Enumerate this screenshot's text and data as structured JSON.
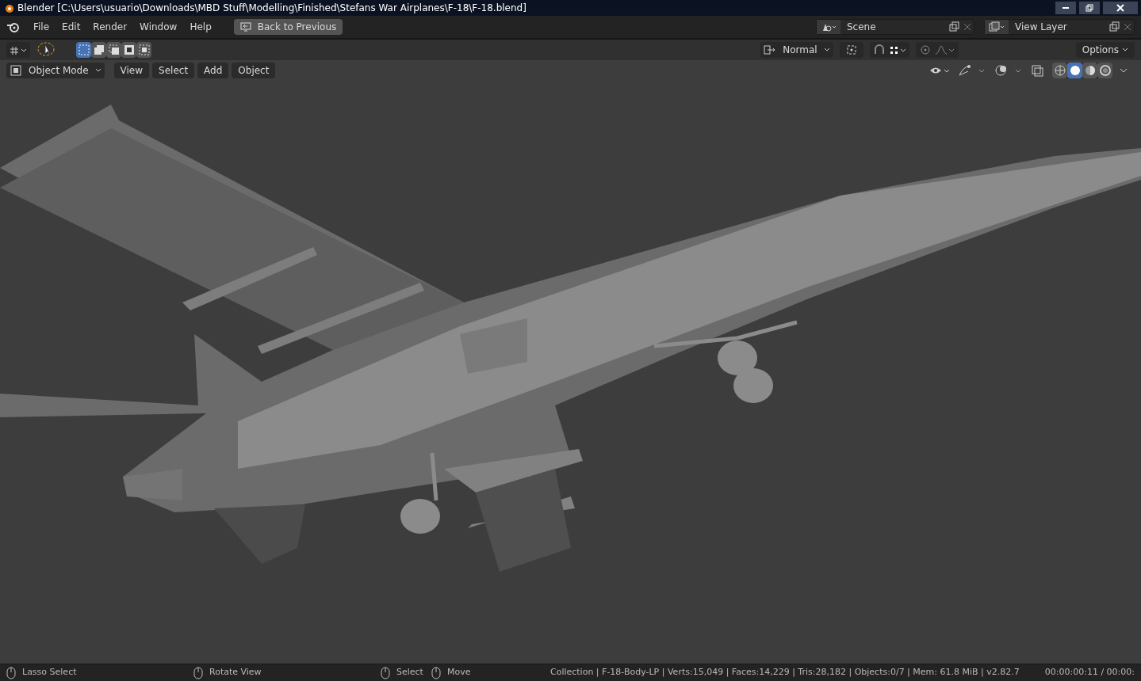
{
  "window": {
    "title": "Blender [C:\\Users\\usuario\\Downloads\\MBD Stuff\\Modelling\\Finished\\Stefans War Airplanes\\F-18\\F-18.blend]"
  },
  "top_bar": {
    "menus": [
      "File",
      "Edit",
      "Render",
      "Window",
      "Help"
    ],
    "back_button": "Back to Previous",
    "scene": "Scene",
    "view_layer": "View Layer"
  },
  "tool_header": {
    "select_modes": [
      {
        "selected": true
      },
      {
        "selected": false
      },
      {
        "selected": false
      },
      {
        "selected": false
      },
      {
        "selected": false
      }
    ],
    "orientation": "Normal",
    "options": "Options"
  },
  "viewport_header": {
    "mode": "Object Mode",
    "menus": [
      "View",
      "Select",
      "Add",
      "Object"
    ],
    "shading": [
      {
        "selected": false
      },
      {
        "selected": true
      },
      {
        "selected": false
      },
      {
        "selected": false
      }
    ]
  },
  "status_bar": {
    "hints": [
      {
        "label": "Lasso Select"
      },
      {
        "label": "Rotate View"
      },
      {
        "label": "Select"
      },
      {
        "label": "Move"
      }
    ],
    "stats": "Collection | F-18-Body-LP | Verts:15,049 | Faces:14,229 | Tris:28,182 | Objects:0/7 | Mem: 61.8 MiB | v2.82.7",
    "time": "00:00:00:11 / 00:00:"
  }
}
